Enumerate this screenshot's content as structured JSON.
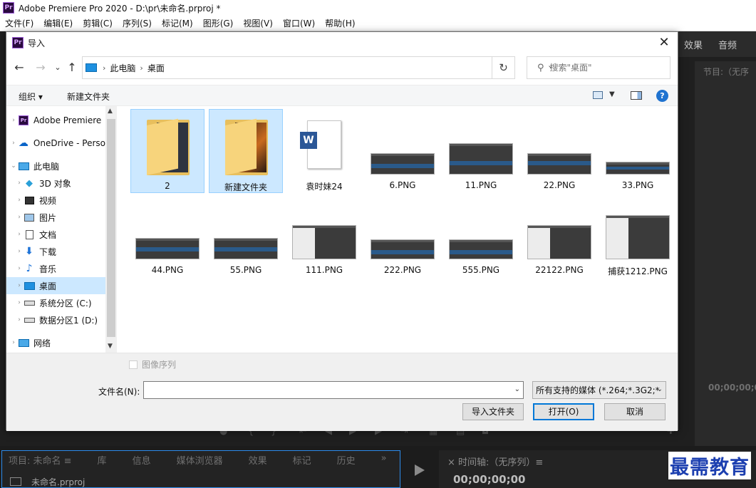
{
  "app": {
    "title": "Adobe Premiere Pro 2020 - D:\\pr\\未命名.prproj *",
    "logo": "Pr",
    "menu": [
      "文件(F)",
      "编辑(E)",
      "剪辑(C)",
      "序列(S)",
      "标记(M)",
      "图形(G)",
      "视图(V)",
      "窗口(W)",
      "帮助(H)"
    ],
    "right_tabs": [
      "效果",
      "音频"
    ],
    "program_label": "节目:（无序",
    "program_timecode": "00;00;00;0",
    "project_tabs": [
      "项目: 未命名 ≡",
      "库",
      "信息",
      "媒体浏览器",
      "效果",
      "标记",
      "历史"
    ],
    "project_more": "»",
    "project_file": "未命名.prproj",
    "timeline_close": "×",
    "timeline_label": "时间轴:（无序列）≡",
    "timeline_timecode": "00;00;00;00"
  },
  "dialog": {
    "title": "导入",
    "close": "✕",
    "nav": {
      "back": "←",
      "forward": "→",
      "recent": "⌄",
      "up": "↑"
    },
    "breadcrumb": [
      "此电脑",
      "桌面"
    ],
    "refresh": "↻",
    "search_placeholder": "搜索\"桌面\"",
    "toolbar": {
      "organize": "组织 ▾",
      "new_folder": "新建文件夹"
    },
    "help": "?",
    "sidebar": [
      {
        "label": "Adobe Premiere",
        "icon": "premiere-icon",
        "chev": "›",
        "indent": 0
      },
      {
        "label": "OneDrive - Perso",
        "icon": "onedrive-icon",
        "chev": "›",
        "indent": 0
      },
      {
        "label": "此电脑",
        "icon": "computer-icon",
        "chev": "⌄",
        "indent": 0
      },
      {
        "label": "3D 对象",
        "icon": "3d-objects-icon",
        "chev": "›",
        "indent": 1
      },
      {
        "label": "视频",
        "icon": "video-icon",
        "chev": "›",
        "indent": 1
      },
      {
        "label": "图片",
        "icon": "pictures-icon",
        "chev": "›",
        "indent": 1
      },
      {
        "label": "文档",
        "icon": "documents-icon",
        "chev": "›",
        "indent": 1
      },
      {
        "label": "下载",
        "icon": "downloads-icon",
        "chev": "›",
        "indent": 1
      },
      {
        "label": "音乐",
        "icon": "music-icon",
        "chev": "›",
        "indent": 1
      },
      {
        "label": "桌面",
        "icon": "desktop-icon",
        "chev": "›",
        "indent": 1,
        "selected": true
      },
      {
        "label": "系统分区 (C:)",
        "icon": "drive-icon",
        "chev": "›",
        "indent": 1
      },
      {
        "label": "数据分区1 (D:)",
        "icon": "drive-icon",
        "chev": "›",
        "indent": 1
      },
      {
        "label": "网络",
        "icon": "network-icon",
        "chev": "›",
        "indent": 0
      }
    ],
    "files": [
      {
        "name": "2",
        "kind": "folder",
        "selected": true
      },
      {
        "name": "新建文件夹",
        "kind": "folder-photo",
        "selected": true
      },
      {
        "name": "袁时妹24",
        "kind": "word"
      },
      {
        "name": "6.PNG",
        "kind": "png"
      },
      {
        "name": "11.PNG",
        "kind": "png"
      },
      {
        "name": "22.PNG",
        "kind": "png"
      },
      {
        "name": "33.PNG",
        "kind": "png"
      },
      {
        "name": "44.PNG",
        "kind": "png"
      },
      {
        "name": "55.PNG",
        "kind": "png"
      },
      {
        "name": "111.PNG",
        "kind": "png"
      },
      {
        "name": "222.PNG",
        "kind": "png"
      },
      {
        "name": "555.PNG",
        "kind": "png"
      },
      {
        "name": "22122.PNG",
        "kind": "png"
      },
      {
        "name": "捕获1212.PNG",
        "kind": "png"
      }
    ],
    "image_sequence_label": "图像序列",
    "filename_label": "文件名(N):",
    "filename_value": "",
    "filetype": "所有支持的媒体 (*.264;*.3G2;*",
    "buttons": {
      "import_folder": "导入文件夹",
      "open": "打开(O)",
      "cancel": "取消"
    }
  },
  "watermark": "最需教育",
  "colors": {
    "selection": "#cce8ff",
    "accent": "#0078d7",
    "premiere_bg": "#1f1f1f"
  }
}
